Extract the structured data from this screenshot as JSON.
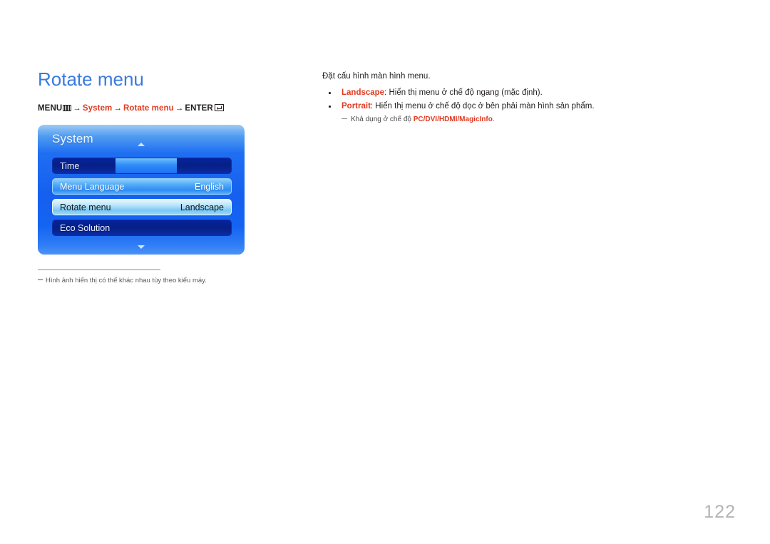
{
  "page": {
    "number": "122"
  },
  "left": {
    "title": "Rotate menu",
    "breadcrumb": {
      "menu_label": "MENU",
      "menu_icon": "menu-grid-icon",
      "arrow": "→",
      "step1": "System",
      "step2": "Rotate menu",
      "enter_label": "ENTER",
      "enter_icon": "enter-return-icon"
    },
    "osd": {
      "title": "System",
      "scroll_up_icon": "caret-up-icon",
      "scroll_down_icon": "caret-down-icon",
      "rows": [
        {
          "label": "Time",
          "value": "",
          "style": "dark-with-fill"
        },
        {
          "label": "Menu Language",
          "value": "English",
          "style": "mid"
        },
        {
          "label": "Rotate menu",
          "value": "Landscape",
          "style": "light"
        },
        {
          "label": "Eco Solution",
          "value": "",
          "style": "dark"
        }
      ]
    },
    "footnote": {
      "dash": "–",
      "text": "Hình ảnh hiển thị có thể khác nhau tùy theo kiểu máy."
    }
  },
  "right": {
    "intro": "Đặt cấu hình màn hình menu.",
    "bullets": [
      {
        "keyword": "Landscape",
        "rest": ": Hiển thị menu ở chế độ ngang (mặc định)."
      },
      {
        "keyword": "Portrait",
        "rest": ": Hiển thị menu ở chế độ dọc ở bên phải màn hình sản phẩm."
      }
    ],
    "subnote": {
      "prefix": "Khả dụng ở chế độ ",
      "modes": "PC/DVI/HDMI/MagicInfo",
      "suffix": "."
    }
  },
  "colors": {
    "heading_blue": "#3a7ae0",
    "keyword_red": "#e03a23",
    "osd_panel_blue": "#1f6ef2",
    "osd_row_navy": "#062084",
    "page_number_gray": "#b3b3b3"
  }
}
